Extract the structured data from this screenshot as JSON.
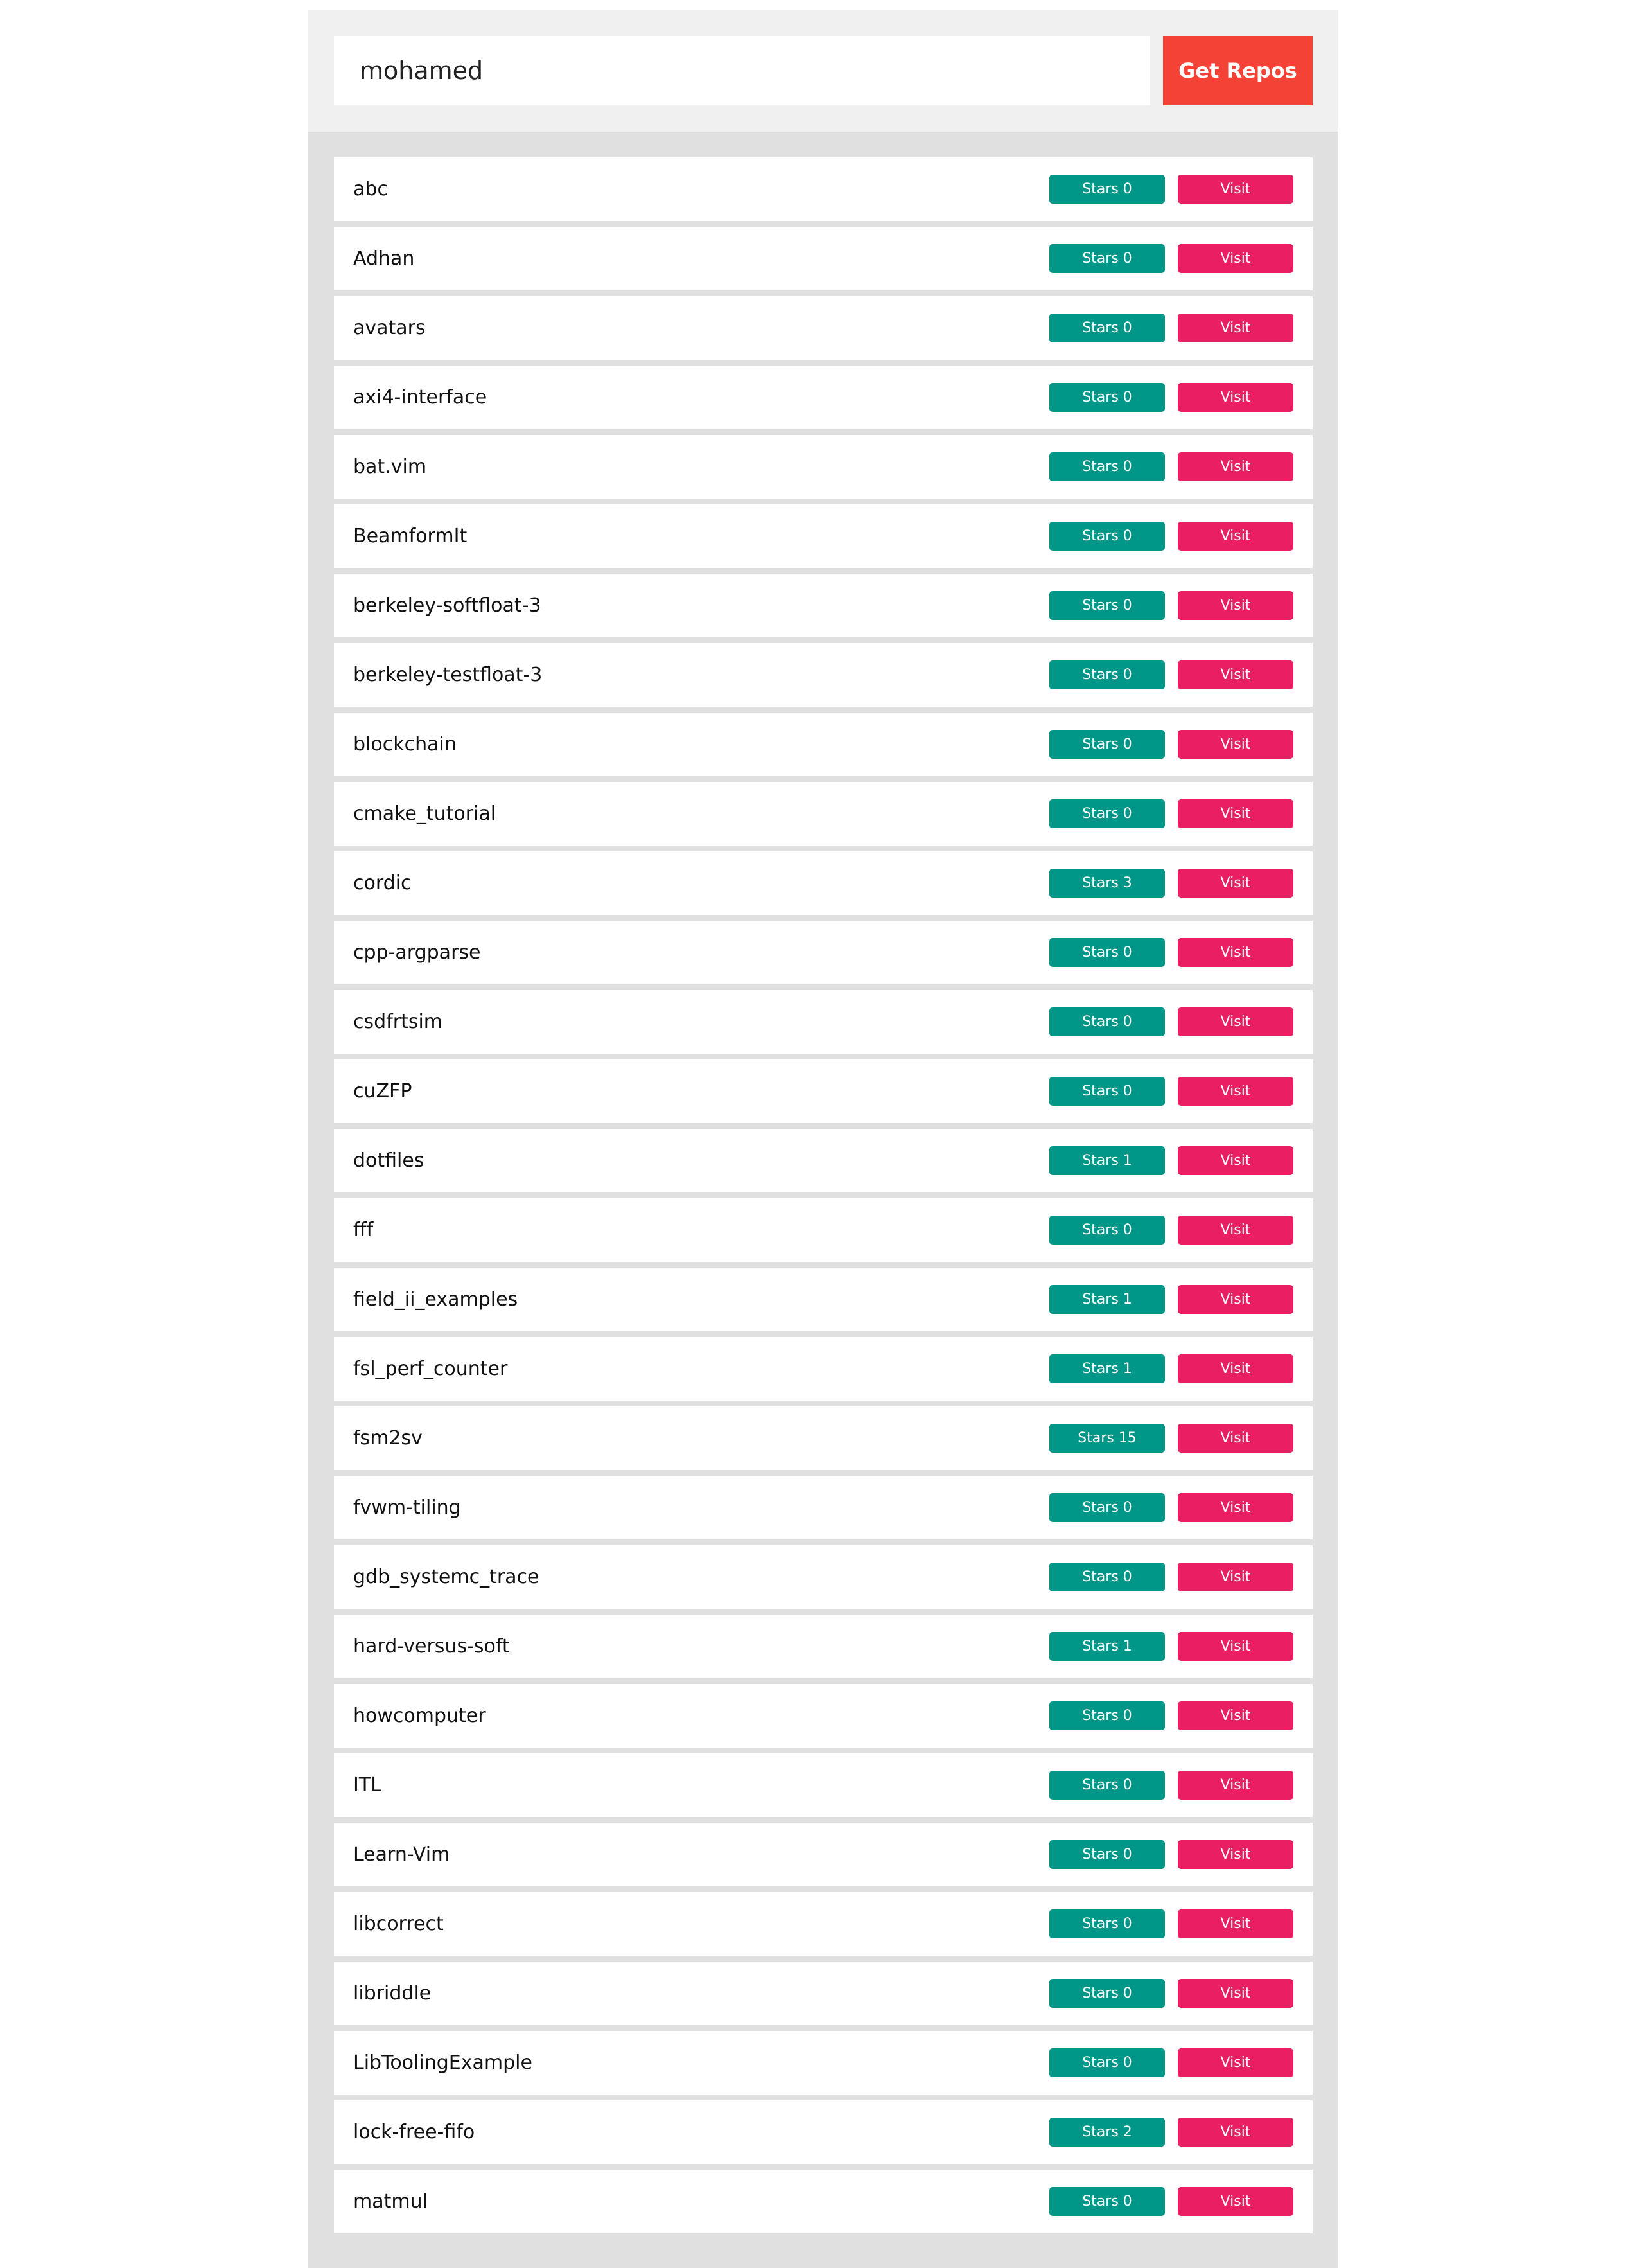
{
  "search": {
    "value": "mohamed",
    "button_label": "Get Repos"
  },
  "labels": {
    "stars_prefix": "Stars",
    "visit": "Visit"
  },
  "colors": {
    "button": "#f44336",
    "stars_badge": "#009688",
    "visit_button": "#e91e63"
  },
  "repos": [
    {
      "name": "abc",
      "stars": 0
    },
    {
      "name": "Adhan",
      "stars": 0
    },
    {
      "name": "avatars",
      "stars": 0
    },
    {
      "name": "axi4-interface",
      "stars": 0
    },
    {
      "name": "bat.vim",
      "stars": 0
    },
    {
      "name": "BeamformIt",
      "stars": 0
    },
    {
      "name": "berkeley-softfloat-3",
      "stars": 0
    },
    {
      "name": "berkeley-testfloat-3",
      "stars": 0
    },
    {
      "name": "blockchain",
      "stars": 0
    },
    {
      "name": "cmake_tutorial",
      "stars": 0
    },
    {
      "name": "cordic",
      "stars": 3
    },
    {
      "name": "cpp-argparse",
      "stars": 0
    },
    {
      "name": "csdfrtsim",
      "stars": 0
    },
    {
      "name": "cuZFP",
      "stars": 0
    },
    {
      "name": "dotfiles",
      "stars": 1
    },
    {
      "name": "fff",
      "stars": 0
    },
    {
      "name": "field_ii_examples",
      "stars": 1
    },
    {
      "name": "fsl_perf_counter",
      "stars": 1
    },
    {
      "name": "fsm2sv",
      "stars": 15
    },
    {
      "name": "fvwm-tiling",
      "stars": 0
    },
    {
      "name": "gdb_systemc_trace",
      "stars": 0
    },
    {
      "name": "hard-versus-soft",
      "stars": 1
    },
    {
      "name": "howcomputer",
      "stars": 0
    },
    {
      "name": "ITL",
      "stars": 0
    },
    {
      "name": "Learn-Vim",
      "stars": 0
    },
    {
      "name": "libcorrect",
      "stars": 0
    },
    {
      "name": "libriddle",
      "stars": 0
    },
    {
      "name": "LibToolingExample",
      "stars": 0
    },
    {
      "name": "lock-free-fifo",
      "stars": 2
    },
    {
      "name": "matmul",
      "stars": 0
    }
  ]
}
